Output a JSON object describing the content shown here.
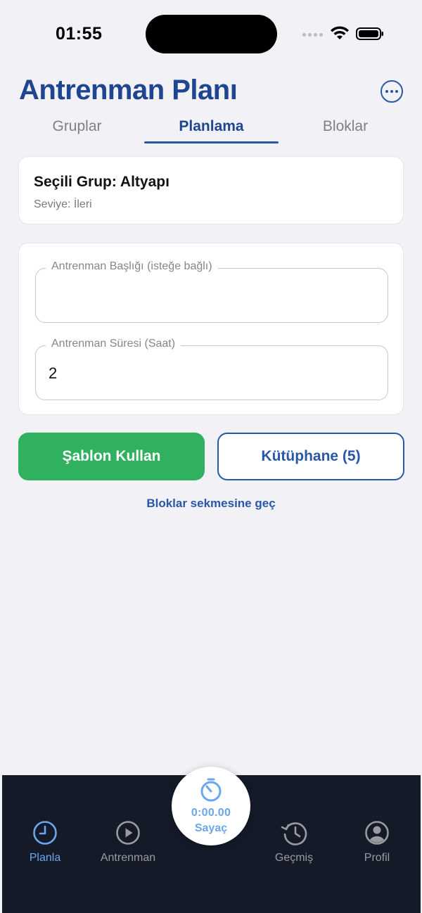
{
  "status_bar": {
    "time": "01:55"
  },
  "header": {
    "title": "Antrenman Planı"
  },
  "tabs": [
    {
      "label": "Gruplar",
      "active": false
    },
    {
      "label": "Planlama",
      "active": true
    },
    {
      "label": "Bloklar",
      "active": false
    }
  ],
  "group_card": {
    "title": "Seçili Grup: Altyapı",
    "level": "Seviye: İleri"
  },
  "form": {
    "title_field": {
      "label": "Antrenman Başlığı (isteğe bağlı)",
      "value": ""
    },
    "duration_field": {
      "label": "Antrenman Süresi (Saat)",
      "value": "2"
    }
  },
  "actions": {
    "template_label": "Şablon Kullan",
    "library_label": "Kütüphane (5)",
    "blocks_link": "Bloklar sekmesine geç"
  },
  "tab_bar": {
    "items": [
      {
        "label": "Planla",
        "icon": "clock-icon",
        "active": true
      },
      {
        "label": "Antrenman",
        "icon": "play-circle-icon",
        "active": false
      },
      {
        "label": "Geçmiş",
        "icon": "history-icon",
        "active": false
      },
      {
        "label": "Profil",
        "icon": "person-circle-icon",
        "active": false
      }
    ],
    "timer": {
      "value": "0:00.00",
      "label": "Sayaç"
    }
  },
  "colors": {
    "primary": "#1e4690",
    "accent": "#2a57a8",
    "success": "#30b15f",
    "tab_bar_bg": "#151a29",
    "active_nav": "#6aa7ee"
  }
}
